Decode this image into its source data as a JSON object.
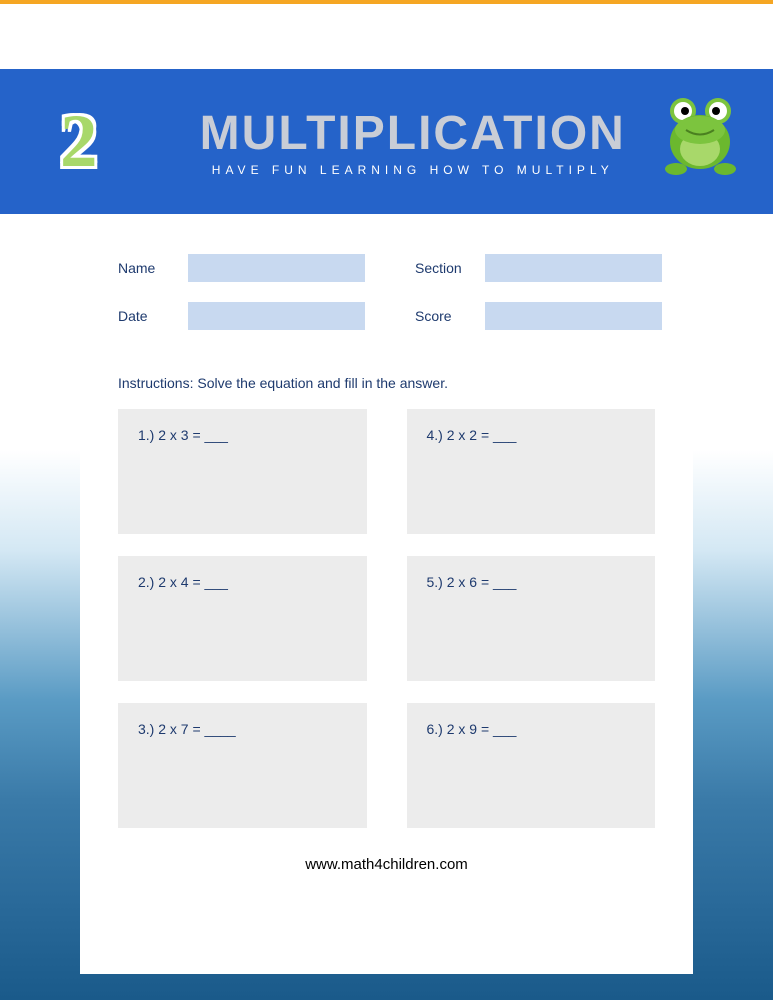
{
  "banner": {
    "number": "2",
    "title": "MULTIPLICATION",
    "subtitle": "HAVE FUN LEARNING HOW TO MULTIPLY"
  },
  "fields": {
    "name": {
      "label": "Name",
      "value": ""
    },
    "section": {
      "label": "Section",
      "value": ""
    },
    "date": {
      "label": "Date",
      "value": ""
    },
    "score": {
      "label": "Score",
      "value": ""
    }
  },
  "instructions": "Instructions: Solve the equation and fill in the answer.",
  "problems": {
    "p1": "1.)  2 x 3 = ___",
    "p2": "2.) 2 x 4 = ___",
    "p3": "3.) 2 x 7 = ____",
    "p4": "4.)  2 x 2 = ___",
    "p5": "5.) 2 x  6 = ___",
    "p6": "6.) 2 x 9 = ___"
  },
  "footer": "www.math4children.com"
}
